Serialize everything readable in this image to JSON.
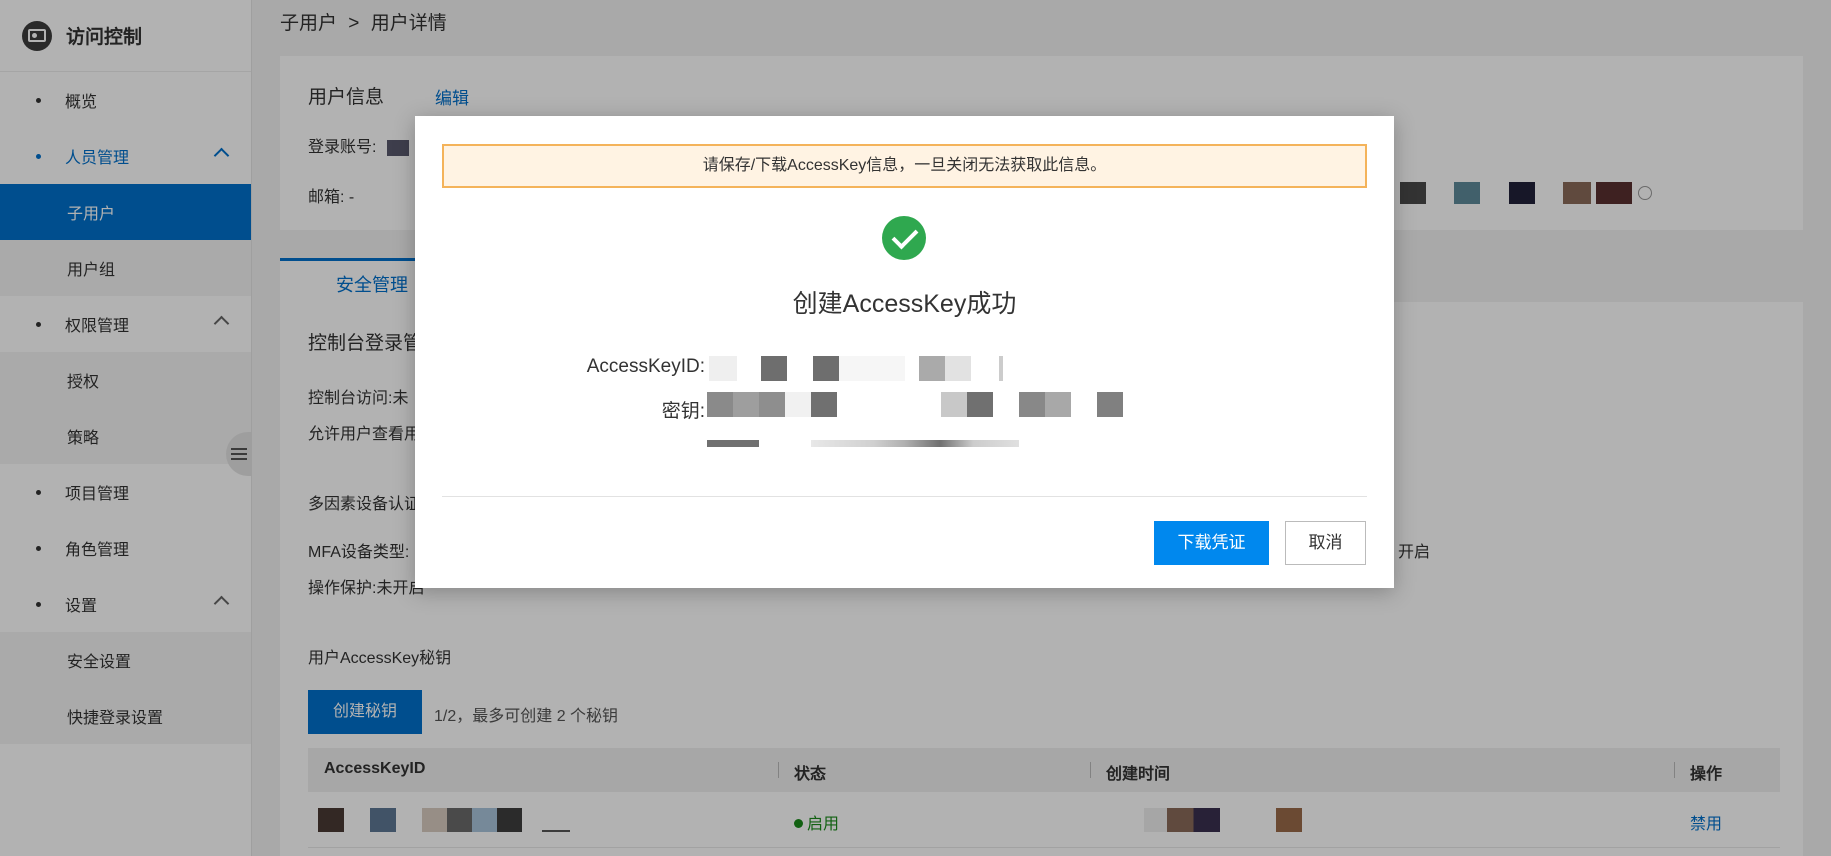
{
  "sidebar": {
    "title": "访问控制",
    "items": [
      {
        "label": "概览"
      },
      {
        "label": "人员管理"
      },
      {
        "label": "子用户"
      },
      {
        "label": "用户组"
      },
      {
        "label": "权限管理"
      },
      {
        "label": "授权"
      },
      {
        "label": "策略"
      },
      {
        "label": "项目管理"
      },
      {
        "label": "角色管理"
      },
      {
        "label": "设置"
      },
      {
        "label": "安全设置"
      },
      {
        "label": "快捷登录设置"
      }
    ]
  },
  "breadcrumb": {
    "parent": "子用户",
    "separator": ">",
    "current": "用户详情"
  },
  "user_info": {
    "title": "用户信息",
    "edit_label": "编辑",
    "login_label": "登录账号:",
    "email_label": "邮箱:",
    "email_value": "-"
  },
  "tabs": {
    "active": "安全管理"
  },
  "security": {
    "console_title": "控制台登录管",
    "console_access": "控制台访问:未",
    "allow_view": "允许用户查看用",
    "mfa_title": "多因素设备认证",
    "mfa_type": "MFA设备类型:",
    "mfa_open_tail": "开启",
    "op_protect": "操作保护:未开启",
    "ak_title": "用户AccessKey秘钥",
    "create_button": "创建秘钥",
    "create_hint": "1/2，最多可创建 2 个秘钥",
    "table": {
      "headers": [
        "AccessKeyID",
        "状态",
        "创建时间",
        "操作"
      ],
      "rows": [
        {
          "status": "启用",
          "action": "禁用"
        }
      ]
    }
  },
  "modal": {
    "warning": "请保存/下载AccessKey信息，一旦关闭无法获取此信息。",
    "title": "创建AccessKey成功",
    "ak_id_label": "AccessKeyID:",
    "secret_label": "密钥:",
    "download_button": "下载凭证",
    "cancel_button": "取消"
  },
  "colors": {
    "primary": "#0070cc",
    "modal_primary": "#0088ee",
    "success": "#2fa84f",
    "warning_border": "#f4b35a",
    "warning_bg": "#fff3e3"
  }
}
